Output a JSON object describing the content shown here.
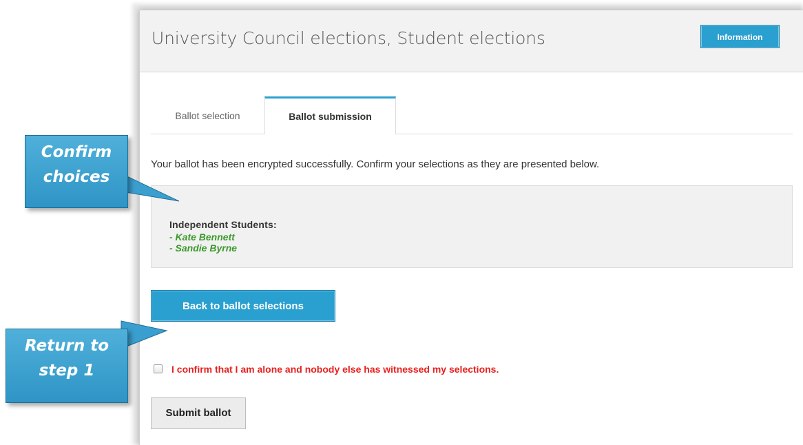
{
  "header": {
    "title": "University Council elections, Student elections",
    "info_button_label": "Information"
  },
  "tabs": [
    {
      "label": "Ballot selection",
      "active": false
    },
    {
      "label": "Ballot submission",
      "active": true
    }
  ],
  "intro_text": "Your ballot has been encrypted successfully. Confirm your selections as they are presented below.",
  "selection": {
    "group_name": "Independent Students:",
    "candidates": [
      "- Kate Bennett",
      "- Sandie Byrne"
    ]
  },
  "back_button_label": "Back to ballot selections",
  "confirm": {
    "label": "I confirm that I am alone and nobody else has witnessed my selections.",
    "checked": false
  },
  "submit_button_label": "Submit ballot",
  "callouts": {
    "confirm_line1": "Confirm",
    "confirm_line2": "choices",
    "return_line1": "Return to",
    "return_line2": "step 1"
  },
  "colors": {
    "accent": "#2aa0d0",
    "candidate": "#3a9a2a",
    "warning": "#e8211f",
    "callout": "#3a9fcf"
  }
}
